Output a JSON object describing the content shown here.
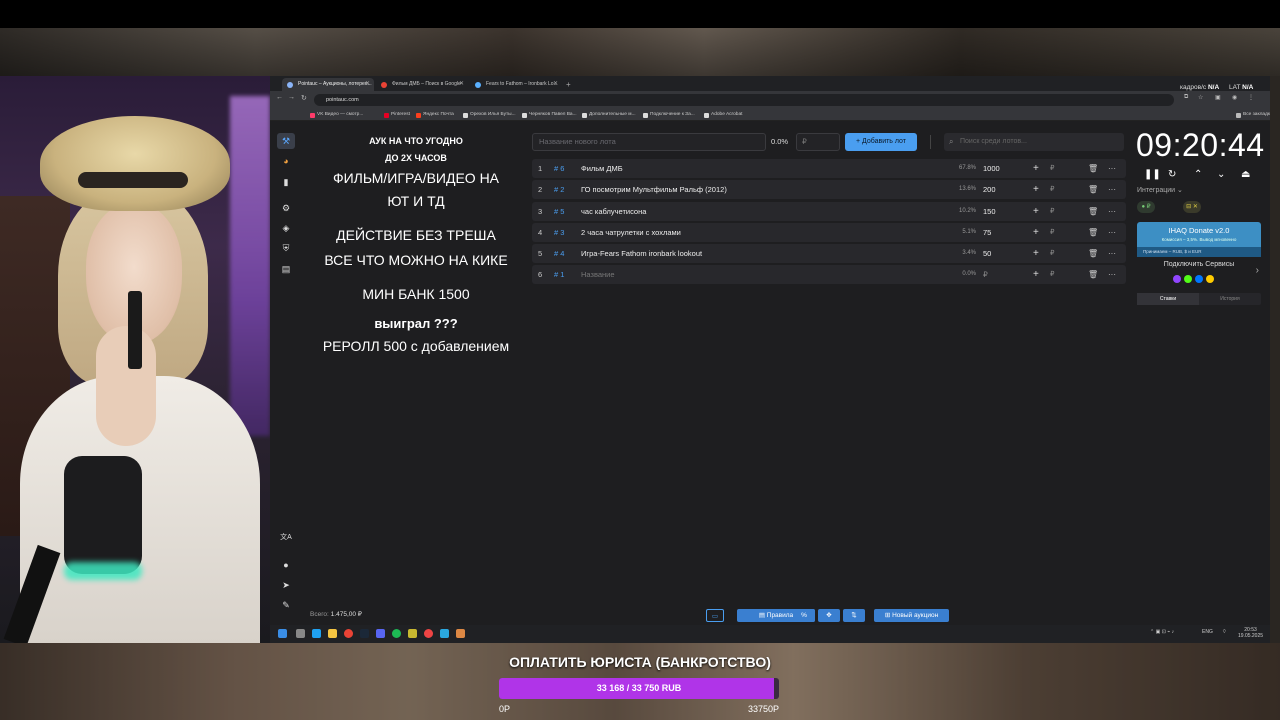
{
  "browser": {
    "tabs": [
      {
        "label": "Pointauc – Аукционы, лотерея..."
      },
      {
        "label": "Фильм ДМБ – Поиск в Google"
      },
      {
        "label": "Fears to Fathom – Ironbark Lo..."
      }
    ],
    "url": "pointauc.com",
    "bookmarks": [
      {
        "label": "VK Видео — смотр..."
      },
      {
        "label": "Pinterest"
      },
      {
        "label": "Яндекс Почта"
      },
      {
        "label": "Орехов Илья Буты..."
      },
      {
        "label": "Черняков Павел Ва..."
      },
      {
        "label": "Дополнительные м..."
      },
      {
        "label": "Подключение к За..."
      },
      {
        "label": "Adobe Acrobat"
      }
    ],
    "other_bookmarks": "Все закладки"
  },
  "recorder": {
    "fps_label": "кадров/с",
    "fps_value": "N/A",
    "lat_label": "LAT",
    "lat_value": "N/A"
  },
  "notes": {
    "line1": "АУК НА ЧТО УГОДНО",
    "line2": "ДО 2Х ЧАСОВ",
    "line3": "ФИЛЬМ/ИГРА/ВИДЕО НА",
    "line4": "ЮТ И ТД",
    "line5": "ДЕЙСТВИЕ БЕЗ ТРЕША",
    "line6": "ВСЕ ЧТО МОЖНО НА КИКЕ",
    "line7": "МИН БАНК 1500",
    "line8": "выиграл ???",
    "line9": "РЕРОЛЛ 500 с добавлением"
  },
  "toolbar": {
    "new_lot_placeholder": "Название нового лота",
    "percent": "0.0%",
    "amount_placeholder": "₽",
    "add_button": "Добавить лот",
    "search_placeholder": "Поиск среди лотов..."
  },
  "lots": [
    {
      "num": "1",
      "id": "6",
      "name": "Фильм ДМБ",
      "pct": "67.8%",
      "amount": "1000"
    },
    {
      "num": "2",
      "id": "2",
      "name": "ГО посмотрим Мультфильм Ральф (2012)",
      "pct": "13.6%",
      "amount": "200"
    },
    {
      "num": "3",
      "id": "5",
      "name": "час каблучетисона",
      "pct": "10.2%",
      "amount": "150"
    },
    {
      "num": "4",
      "id": "3",
      "name": "2 часа чатрулетки с хохлами",
      "pct": "5.1%",
      "amount": "75"
    },
    {
      "num": "5",
      "id": "4",
      "name": "Игра-Fears Fathom ironbark lookout",
      "pct": "3.4%",
      "amount": "50"
    },
    {
      "num": "6",
      "id": "1",
      "name": "Название",
      "pct": "0.0%",
      "amount": "₽"
    }
  ],
  "row_icons": {
    "plus": "+",
    "rub": "₽",
    "del": "🗑",
    "more": "···"
  },
  "timer": {
    "value": "09:20:44",
    "pause": "❚❚",
    "reset": "↻",
    "up": "⌃",
    "down": "⌄",
    "top": "⏏"
  },
  "integrations": {
    "label": "Интеграции",
    "donate_title": "IHAQ Donate v2.0",
    "donate_sub": "Комиссия – 3,5%. Вывод мгновенно",
    "donate_foot": "Принимаем – RUB, $ и EUR",
    "connect_label": "Подключить Сервисы"
  },
  "history_tabs": [
    {
      "label": "Ставки"
    },
    {
      "label": "История"
    }
  ],
  "status": {
    "total_label": "Всего:",
    "total_value": "1.475,00 ₽",
    "rules": "Правила",
    "new_auction": "Новый аукцион"
  },
  "taskbar": {
    "lang": "ENG",
    "time": "20:53",
    "date": "19.05.2025"
  },
  "goal": {
    "title": "ОПЛАТИТЬ ЮРИСТА (БАНКРОТСТВО)",
    "progress_text": "33 168 / 33 750 RUB",
    "current": 33168,
    "target": 33750,
    "min_label": "0P",
    "max_label": "33750P",
    "fill_color": "#b034e8"
  }
}
